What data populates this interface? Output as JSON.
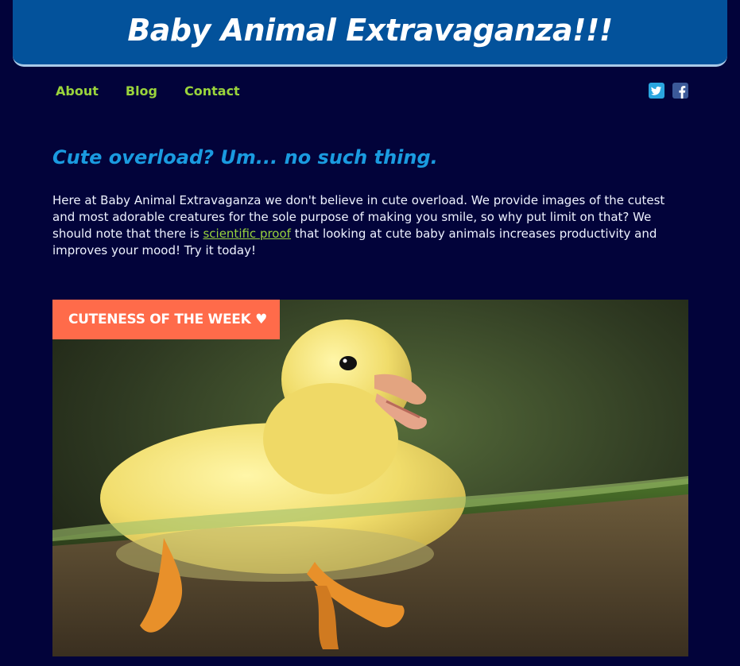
{
  "header": {
    "title": "Baby Animal Extravaganza!!!",
    "bg_color": "#03529b"
  },
  "nav": {
    "items": [
      {
        "label": "About"
      },
      {
        "label": "Blog"
      },
      {
        "label": "Contact"
      }
    ],
    "color": "#9ad43c"
  },
  "social": {
    "icons": [
      "twitter-icon",
      "facebook-icon"
    ]
  },
  "main": {
    "tagline": "Cute overload? Um... no such thing.",
    "intro_before_link": "Here at Baby Animal Extravaganza we don't believe in cute overload. We provide images of the cutest and most adorable creatures for the sole purpose of making you smile, so why put limit on that? We should note that there is ",
    "intro_link": "scientific proof",
    "intro_after_link": " that looking at cute baby animals increases productivity and improves your mood! Try it today!"
  },
  "feature": {
    "badge": "CUTENESS OF THE WEEK ♥",
    "badge_color": "#ff6b4a",
    "image_subject": "yellow duckling swimming in water"
  },
  "colors": {
    "page_bg": "#02033a",
    "tagline": "#1a9be0",
    "body_text": "#eef2ff"
  }
}
